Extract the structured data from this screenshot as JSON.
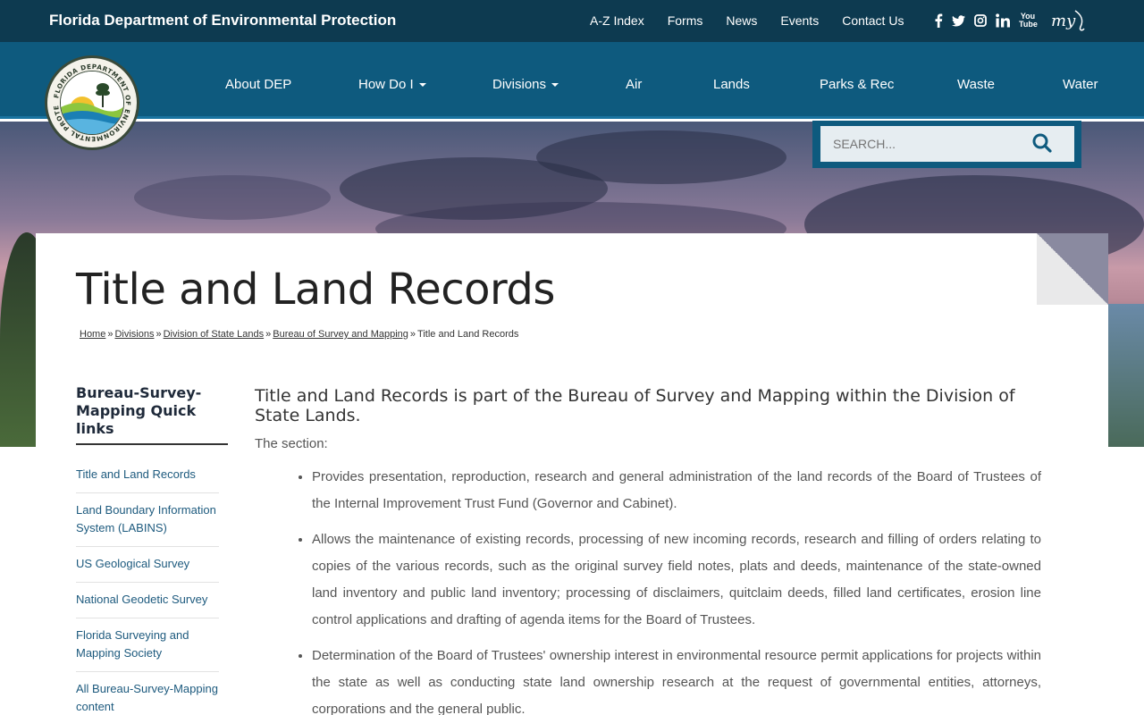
{
  "header": {
    "site_title": "Florida Department of Environmental Protection",
    "utility_links": [
      "A-Z Index",
      "Forms",
      "News",
      "Events",
      "Contact Us"
    ],
    "social_icons": [
      "facebook-icon",
      "twitter-icon",
      "instagram-icon",
      "linkedin-icon",
      "youtube-icon",
      "myflorida-icon"
    ],
    "social_text": {
      "youtube": "You Tube",
      "myflorida": "my"
    }
  },
  "logo": {
    "text": "FLORIDA DEPARTMENT OF ENVIRONMENTAL PROTECTION"
  },
  "nav": {
    "items": [
      "About DEP",
      "How Do I",
      "Divisions",
      "Air",
      "Lands",
      "Parks & Rec",
      "Waste",
      "Water"
    ]
  },
  "search": {
    "placeholder": "SEARCH..."
  },
  "page": {
    "title": "Title and Land Records",
    "breadcrumb": [
      "Home",
      "Divisions",
      "Division of State Lands",
      "Bureau of Survey and Mapping",
      "Title and Land Records"
    ]
  },
  "sidebar": {
    "heading": "Bureau-Survey-Mapping Quick links",
    "items": [
      "Title and Land Records",
      "Land Boundary Information System (LABINS)",
      "US Geological Survey",
      "National Geodetic Survey",
      "Florida Surveying and Mapping Society",
      "All Bureau-Survey-Mapping content"
    ]
  },
  "content": {
    "lead": "Title and Land Records is part of the Bureau of Survey and Mapping within the Division of State Lands.",
    "section_label": "The section:",
    "bullets": [
      "Provides presentation, reproduction, research and general administration of the land records of the Board of Trustees of the Internal Improvement Trust Fund (Governor and Cabinet).",
      "Allows the maintenance of existing records, processing of new incoming records, research and filling of orders relating to copies of the various records, such as the original survey field notes, plats and deeds, maintenance of the state-owned land inventory and public land inventory; processing of disclaimers, quitclaim deeds, filled land certificates, erosion line control applications and drafting of agenda items for the Board of Trustees.",
      "Determination of the Board of Trustees' ownership interest in environmental resource permit applications for projects within the state as well as conducting state land ownership research at the request of governmental entities, attorneys, corporations and the general public."
    ]
  }
}
